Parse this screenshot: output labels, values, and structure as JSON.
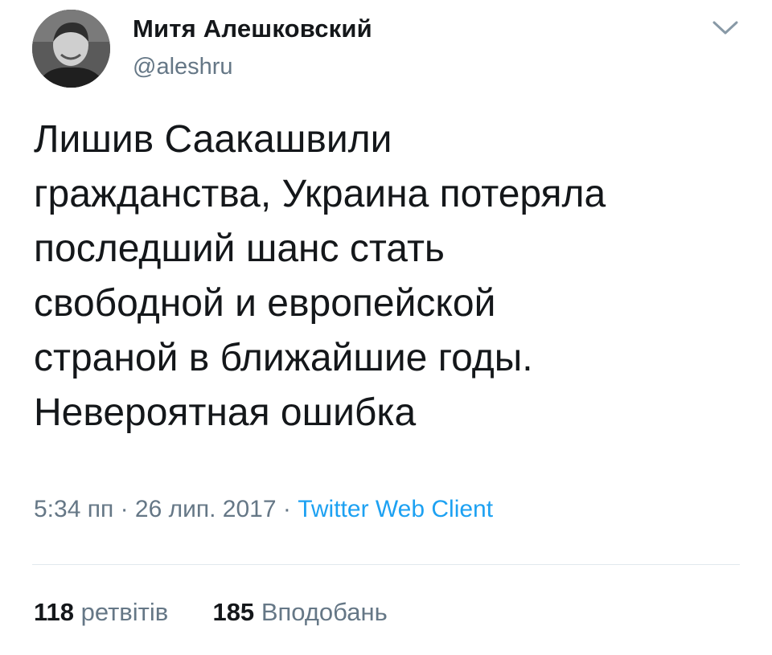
{
  "author": {
    "name": "Митя Алешковский",
    "handle": "@aleshru"
  },
  "tweet": {
    "lines": [
      "Лишив Саакашвили",
      "гражданства, Украина потеряла",
      "последший шанс стать",
      "свободной и европейской",
      "страной в ближайшие годы.",
      "Невероятная ошибка"
    ],
    "time": "5:34 пп",
    "date": "26 лип. 2017",
    "separator": "·",
    "client": "Twitter Web Client"
  },
  "stats": {
    "retweets_count": "118",
    "retweets_label": "ретвітів",
    "likes_count": "185",
    "likes_label": "Вподобань"
  },
  "colors": {
    "text": "#14171a",
    "secondary": "#657786",
    "link": "#1da1f2",
    "divider": "#e1e8ed"
  },
  "icons": {
    "menu": "chevron-down-icon"
  }
}
